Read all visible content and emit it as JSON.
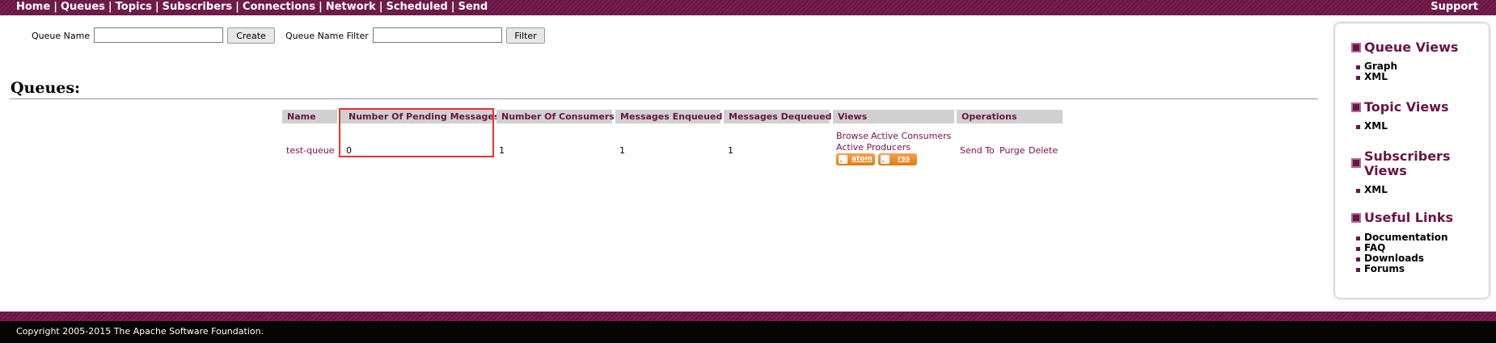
{
  "nav": {
    "items": [
      "Home",
      "Queues",
      "Topics",
      "Subscribers",
      "Connections",
      "Network",
      "Scheduled",
      "Send"
    ],
    "separator": "|",
    "support": "Support"
  },
  "create_form": {
    "label": "Queue Name",
    "value": "",
    "button": "Create"
  },
  "filter_form": {
    "label": "Queue Name Filter",
    "value": "",
    "button": "Filter"
  },
  "heading": "Queues:",
  "table": {
    "headers": [
      "Name",
      "Number Of Pending Messages",
      "Number Of Consumers",
      "Messages Enqueued",
      "Messages Dequeued",
      "Views",
      "Operations"
    ],
    "rows": [
      {
        "name": "test-queue",
        "pending": "0",
        "consumers": "1",
        "enqueued": "1",
        "dequeued": "1",
        "views": [
          "Browse",
          "Active Consumers",
          "Active Producers"
        ],
        "feeds": [
          "atom",
          "rss"
        ],
        "operations": [
          "Send To",
          "Purge",
          "Delete"
        ]
      }
    ]
  },
  "sidebar": {
    "sections": [
      {
        "title": "Queue Views",
        "items": [
          "Graph",
          "XML"
        ]
      },
      {
        "title": "Topic Views",
        "items": [
          "XML"
        ]
      },
      {
        "title_lines": [
          "Subscribers",
          "Views"
        ],
        "items": [
          "XML"
        ]
      },
      {
        "title": "Useful Links",
        "items": [
          "Documentation",
          "FAQ",
          "Downloads",
          "Forums"
        ]
      }
    ]
  },
  "footer": {
    "copyright": "Copyright 2005-2015 The Apache Software Foundation."
  },
  "colors": {
    "brand": "#6a1444",
    "highlight": "#e8322f",
    "header_bg": "#d0d0d0",
    "feed": "#e27a13"
  }
}
